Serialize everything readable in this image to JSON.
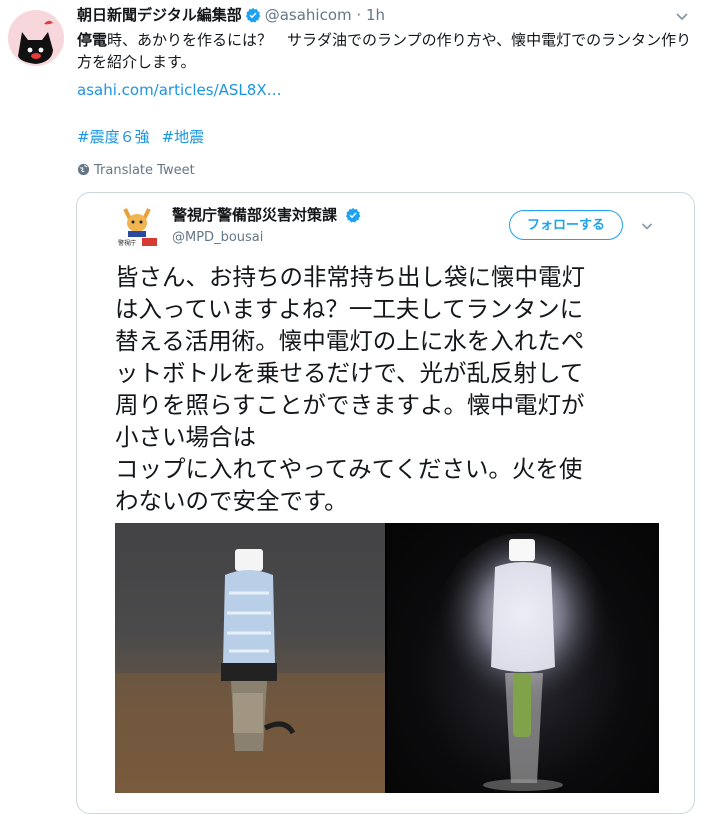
{
  "tweet": {
    "author_name": "朝日新聞デジタル編集部",
    "author_handle": "@asahicom",
    "separator": "·",
    "time": "1h",
    "text_bold": "停電",
    "text_rest": "時、あかりを作るには？　サラダ油でのランプの作り方や、懐中電灯でのランタン作り方を紹介します。",
    "link": "asahi.com/articles/ASL8X…",
    "hashtags": [
      "#震度６強",
      "#地震"
    ],
    "translate_label": "Translate Tweet"
  },
  "quoted": {
    "name": "警視庁警備部災害対策課",
    "handle": "@MPD_bousai",
    "follow_label": "フォローする",
    "text_lines": [
      "皆さん、お持ちの非常持ち出し袋に懐中電灯",
      "は入っていますよね？一工夫してランタンに",
      "替える活用術。懐中電灯の上に水を入れたペ",
      "ットボトルを乗せるだけで、光が乱反射して",
      "周りを照らすことができますよ。懐中電灯が",
      "小さい場合は",
      "コップに入れてやってみてください。火を使",
      "わないので安全です。"
    ],
    "avatar_badge": "警視庁"
  },
  "colors": {
    "link": "#1b95e0",
    "follow": "#1da1f2",
    "secondary_text": "#657786",
    "border": "#ccd6dd"
  },
  "icons": [
    "cat-avatar",
    "verified-badge-icon",
    "chevron-down-icon",
    "globe-icon",
    "police-mascot-avatar"
  ]
}
